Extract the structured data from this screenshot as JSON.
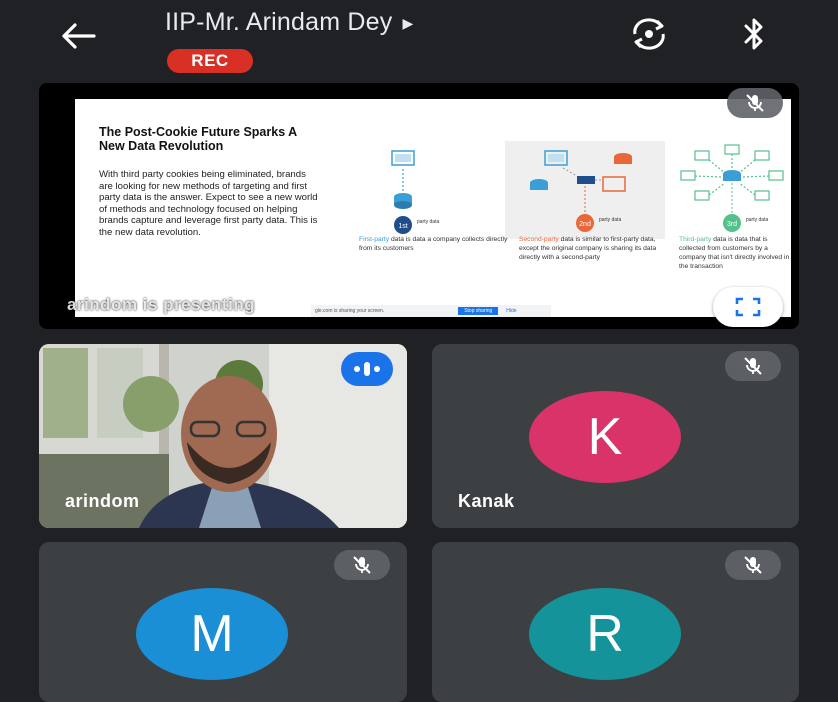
{
  "header": {
    "title": "IIP-Mr. Arindam Dey",
    "title_caret": "▶",
    "rec_label": "REC",
    "icons": [
      "back-arrow-icon",
      "switch-camera-icon",
      "bluetooth-icon"
    ]
  },
  "presentation": {
    "slide_title": "The Post-Cookie Future Sparks A New Data Revolution",
    "slide_body": "With third party cookies being eliminated, brands are looking for new methods of targeting and first party data is the answer. Expect to see a new world of methods and technology focused on helping brands capture and leverage first party data. This is the new data revolution.",
    "diagrams": [
      {
        "label": "party data",
        "num": "1st",
        "color": "#3b9ed6"
      },
      {
        "label": "party data",
        "num": "2nd",
        "color": "#e8683a"
      },
      {
        "label": "party data",
        "num": "3rd",
        "color": "#54c08b"
      }
    ],
    "captions": [
      {
        "highlight": "First-party",
        "rest": " data is data a company collects directly from its customers"
      },
      {
        "highlight": "Second-party",
        "rest": " data is similar to first-party data, except the original company is sharing its data directly with a second-party"
      },
      {
        "highlight": "Third-party",
        "rest": " data is data that is collected from customers by a company that isn't directly involved in the transaction"
      }
    ],
    "share_bar": {
      "text": "gle.com is sharing your screen.",
      "stop": "Stop sharing",
      "hide": "Hide"
    },
    "presenting_label": "arindom is presenting",
    "fullscreen_icon": "fullscreen-icon",
    "muted_icon": "mic-off-icon"
  },
  "participants": [
    {
      "name": "arindom",
      "type": "video",
      "speaking": true
    },
    {
      "name": "Kanak",
      "initial": "K",
      "color": "#d9336a",
      "muted": true
    },
    {
      "name": "",
      "initial": "M",
      "color": "#1a8fd6",
      "muted": true
    },
    {
      "name": "",
      "initial": "R",
      "color": "#14939a",
      "muted": true
    }
  ],
  "colors": {
    "background": "#202124",
    "tile": "#3c4043",
    "rec": "#d93025",
    "speaking": "#1a73e8"
  }
}
